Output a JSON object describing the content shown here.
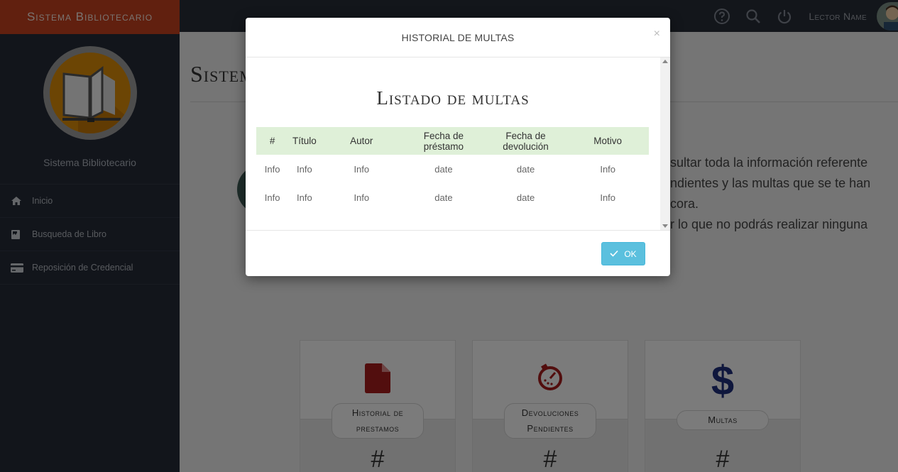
{
  "sidebar": {
    "brand": "Sistema Bibliotecario",
    "title": "Sistema Bibliotecario",
    "items": [
      {
        "label": "Inicio",
        "icon": "home-icon"
      },
      {
        "label": "Busqueda de Libro",
        "icon": "book-icon"
      },
      {
        "label": "Reposición de Credencial",
        "icon": "credit-card-icon"
      }
    ]
  },
  "topbar": {
    "user_name": "Lector Name",
    "icons": [
      "help-icon",
      "search-icon",
      "power-icon"
    ]
  },
  "main": {
    "title_partial": "Sistem",
    "intro_lines": [
      "nsultar toda la información referente",
      "endientes y las multas que se te han",
      "ácora.",
      "or lo que no podrás realizar ninguna"
    ],
    "cards": [
      {
        "label": "Historial de prestamos",
        "count": "#",
        "icon": "document-icon",
        "color": "#a51d1d"
      },
      {
        "label": "Devoluciones Pendientes",
        "count": "#",
        "icon": "clock-icon",
        "color": "#a51d1d"
      },
      {
        "label": "Multas",
        "count": "#",
        "icon": "dollar-icon",
        "color": "#1f2e7a"
      }
    ]
  },
  "modal": {
    "title": "HISTORIAL DE MULTAS",
    "close": "×",
    "heading": "Listado de multas",
    "columns": [
      "#",
      "Título",
      "Autor",
      "Fecha de préstamo",
      "Fecha de devolución",
      "Motivo"
    ],
    "rows": [
      [
        "Info",
        "Info",
        "Info",
        "date",
        "date",
        "Info"
      ],
      [
        "Info",
        "Info",
        "Info",
        "date",
        "date",
        "Info"
      ]
    ],
    "ok_label": "OK"
  },
  "colors": {
    "brand": "#c3401e",
    "sidebar": "#252b36",
    "table_header": "#dff0d8",
    "ok_button": "#5bc0de"
  }
}
